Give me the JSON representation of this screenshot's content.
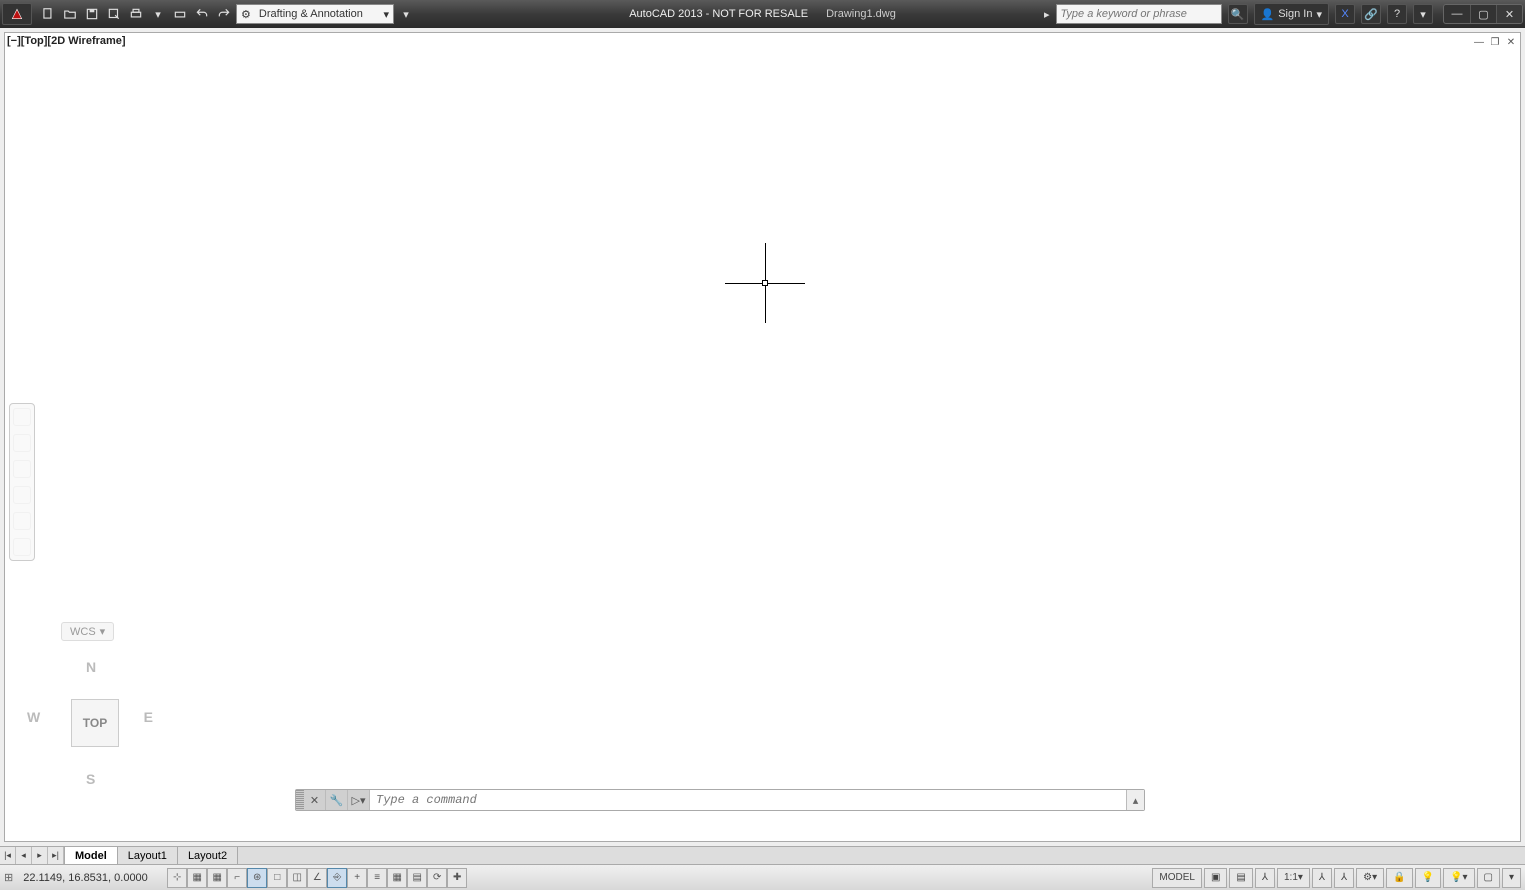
{
  "titlebar": {
    "app_title": "AutoCAD 2013 - NOT FOR RESALE",
    "doc_name": "Drawing1.dwg",
    "workspace": "Drafting & Annotation",
    "search_placeholder": "Type a keyword or phrase",
    "signin_label": "Sign In"
  },
  "doc_window": {
    "viewport_label": "[−][Top][2D Wireframe]"
  },
  "wcs": {
    "label": "WCS"
  },
  "viewcube": {
    "n": "N",
    "s": "S",
    "e": "E",
    "w": "W",
    "face": "TOP"
  },
  "cmdline": {
    "placeholder": "Type a command"
  },
  "layout_tabs": {
    "tabs": [
      {
        "label": "Model",
        "active": true
      },
      {
        "label": "Layout1",
        "active": false
      },
      {
        "label": "Layout2",
        "active": false
      }
    ]
  },
  "statusbar": {
    "coords": "22.1149, 16.8531, 0.0000",
    "model_label": "MODEL",
    "scale_label": "1:1"
  }
}
